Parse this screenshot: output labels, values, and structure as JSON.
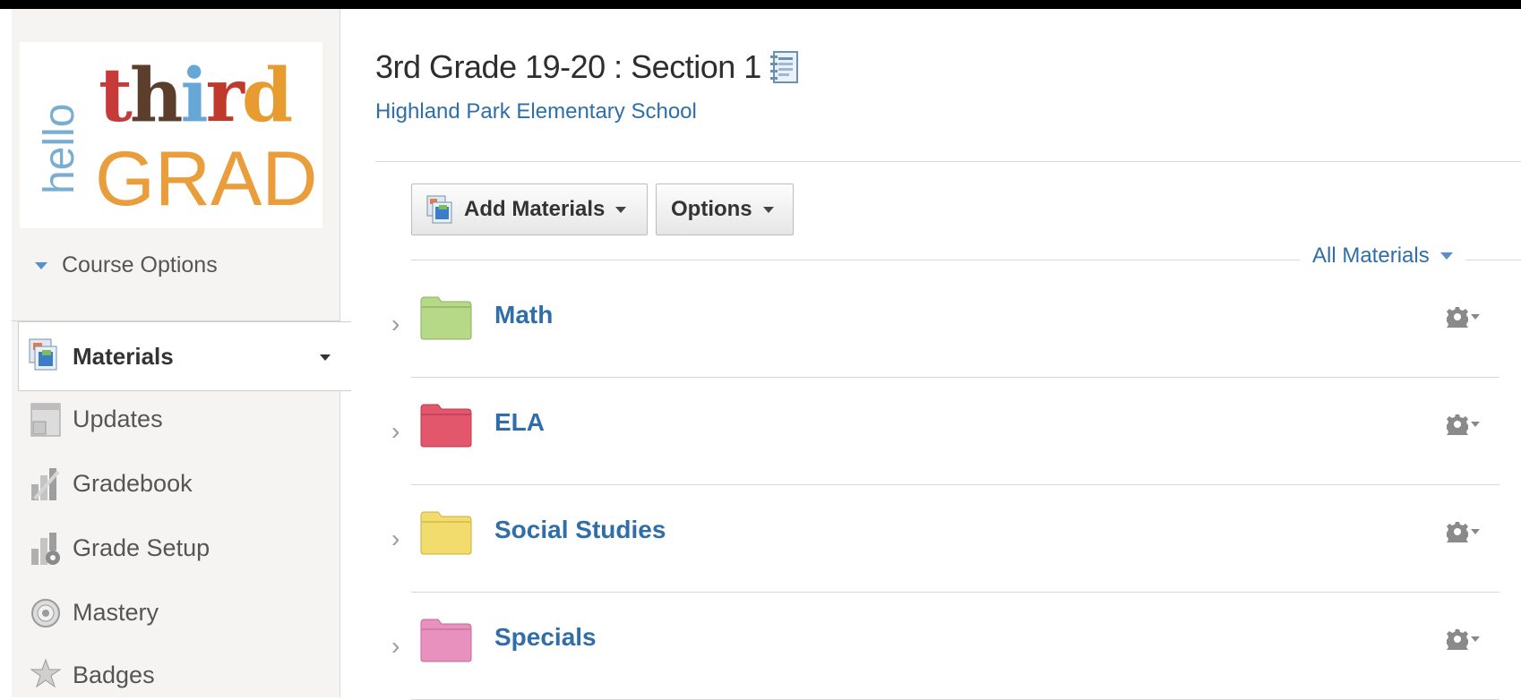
{
  "sidebar": {
    "logo": {
      "hello": "hello",
      "third": "third",
      "grade": "GRADE"
    },
    "course_options_label": "Course Options",
    "active_item": {
      "label": "Materials",
      "icon": "materials-icon"
    },
    "items": [
      {
        "label": "Updates",
        "icon": "updates-icon"
      },
      {
        "label": "Gradebook",
        "icon": "gradebook-icon"
      },
      {
        "label": "Grade Setup",
        "icon": "grade-setup-icon"
      },
      {
        "label": "Mastery",
        "icon": "mastery-icon"
      },
      {
        "label": "Badges",
        "icon": "badges-icon"
      }
    ]
  },
  "header": {
    "title": "3rd Grade 19-20 : Section 1",
    "school": "Highland Park Elementary School"
  },
  "toolbar": {
    "add_materials_label": "Add Materials",
    "options_label": "Options",
    "filter_label": "All Materials"
  },
  "folders": [
    {
      "name": "Math",
      "color": "#b5d987"
    },
    {
      "name": "ELA",
      "color": "#e2576c"
    },
    {
      "name": "Social Studies",
      "color": "#f3dc6e"
    },
    {
      "name": "Specials",
      "color": "#e890be"
    }
  ],
  "colors": {
    "link": "#2f6ea8",
    "accent": "#5b8fc7"
  }
}
